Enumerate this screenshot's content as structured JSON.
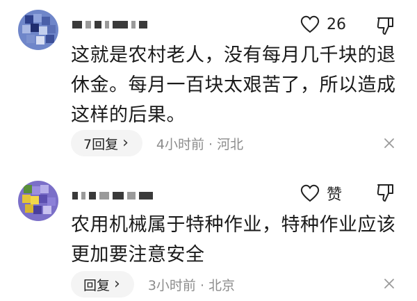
{
  "comments": [
    {
      "likes_label": "26",
      "text": "这就是农村老人，没有每月几千块的退休金。每月一百块太艰苦了，所以造成这样的后果。",
      "reply_label": "7回复",
      "time_location": "4小时前 · 河北",
      "icons": {
        "like": "heart-outline-icon",
        "dislike": "thumbs-down-icon",
        "close": "close-icon",
        "chevron": "chevron-right-icon"
      }
    },
    {
      "likes_label": "赞",
      "text": "农用机械属于特种作业，特种作业应该更加要注意安全",
      "reply_label": "回复",
      "time_location": "3小时前 · 北京",
      "icons": {
        "like": "heart-outline-icon",
        "dislike": "thumbs-down-icon",
        "close": "close-icon",
        "chevron": "chevron-right-icon"
      }
    }
  ],
  "colors": {
    "secondary_text": "#8c8c8c",
    "reply_bg": "#f4f4f4"
  }
}
